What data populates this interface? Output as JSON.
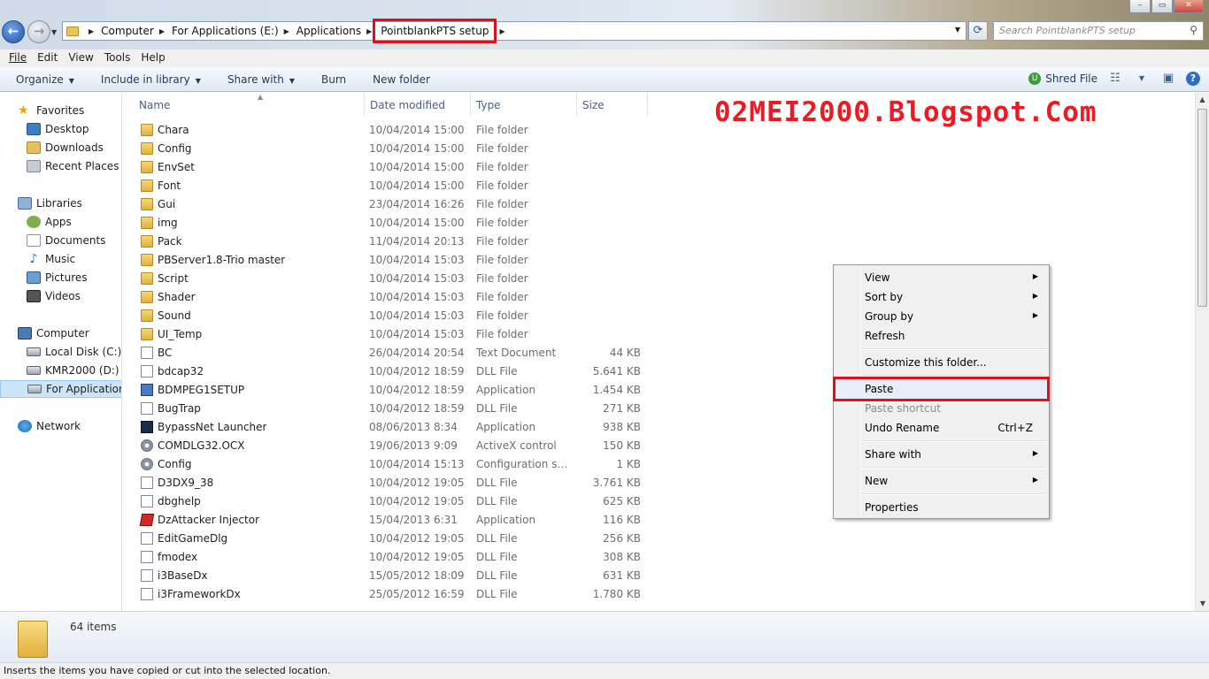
{
  "window": {
    "controls": [
      "–",
      "▭",
      "✕"
    ]
  },
  "address": {
    "crumbs": [
      "Computer",
      "For Applications (E:)",
      "Applications",
      "PointblankPTS setup"
    ],
    "search_placeholder": "Search PointblankPTS setup"
  },
  "menubar": [
    "File",
    "Edit",
    "View",
    "Tools",
    "Help"
  ],
  "commands": {
    "organize": "Organize",
    "include_in_library": "Include in library",
    "share_with": "Share with",
    "burn": "Burn",
    "new_folder": "New folder",
    "shred_file": "Shred File"
  },
  "nav": {
    "favorites": "Favorites",
    "desktop": "Desktop",
    "downloads": "Downloads",
    "recent_places": "Recent Places",
    "libraries": "Libraries",
    "apps": "Apps",
    "documents": "Documents",
    "music": "Music",
    "pictures": "Pictures",
    "videos": "Videos",
    "computer": "Computer",
    "local_disk": "Local Disk (C:)",
    "kmr2000": "KMR2000 (D:)",
    "for_applications": "For Applications",
    "network": "Network"
  },
  "columns": [
    "Name",
    "Date modified",
    "Type",
    "Size"
  ],
  "watermark": "02MEI2000.Blogspot.Com",
  "files": [
    {
      "icon": "folder",
      "name": "Chara",
      "date": "10/04/2014 15:00",
      "type": "File folder",
      "size": ""
    },
    {
      "icon": "folder",
      "name": "Config",
      "date": "10/04/2014 15:00",
      "type": "File folder",
      "size": ""
    },
    {
      "icon": "folder",
      "name": "EnvSet",
      "date": "10/04/2014 15:00",
      "type": "File folder",
      "size": ""
    },
    {
      "icon": "folder",
      "name": "Font",
      "date": "10/04/2014 15:00",
      "type": "File folder",
      "size": ""
    },
    {
      "icon": "folder",
      "name": "Gui",
      "date": "23/04/2014 16:26",
      "type": "File folder",
      "size": ""
    },
    {
      "icon": "folder",
      "name": "img",
      "date": "10/04/2014 15:00",
      "type": "File folder",
      "size": ""
    },
    {
      "icon": "folder",
      "name": "Pack",
      "date": "11/04/2014 20:13",
      "type": "File folder",
      "size": ""
    },
    {
      "icon": "folder",
      "name": "PBServer1.8-Trio master",
      "date": "10/04/2014 15:03",
      "type": "File folder",
      "size": ""
    },
    {
      "icon": "folder",
      "name": "Script",
      "date": "10/04/2014 15:03",
      "type": "File folder",
      "size": ""
    },
    {
      "icon": "folder",
      "name": "Shader",
      "date": "10/04/2014 15:03",
      "type": "File folder",
      "size": ""
    },
    {
      "icon": "folder",
      "name": "Sound",
      "date": "10/04/2014 15:03",
      "type": "File folder",
      "size": ""
    },
    {
      "icon": "folder",
      "name": "UI_Temp",
      "date": "10/04/2014 15:03",
      "type": "File folder",
      "size": ""
    },
    {
      "icon": "file",
      "name": "BC",
      "date": "26/04/2014 20:54",
      "type": "Text Document",
      "size": "44 KB"
    },
    {
      "icon": "file",
      "name": "bdcap32",
      "date": "10/04/2012 18:59",
      "type": "DLL File",
      "size": "5.641 KB"
    },
    {
      "icon": "app",
      "name": "BDMPEG1SETUP",
      "date": "10/04/2012 18:59",
      "type": "Application",
      "size": "1.454 KB"
    },
    {
      "icon": "file",
      "name": "BugTrap",
      "date": "10/04/2012 18:59",
      "type": "DLL File",
      "size": "271 KB"
    },
    {
      "icon": "dark",
      "name": "BypassNet Launcher",
      "date": "08/06/2013 8:34",
      "type": "Application",
      "size": "938 KB"
    },
    {
      "icon": "gear",
      "name": "COMDLG32.OCX",
      "date": "19/06/2013 9:09",
      "type": "ActiveX control",
      "size": "150 KB"
    },
    {
      "icon": "gear",
      "name": "Config",
      "date": "10/04/2014 15:13",
      "type": "Configuration sett...",
      "size": "1 KB"
    },
    {
      "icon": "file",
      "name": "D3DX9_38",
      "date": "10/04/2012 19:05",
      "type": "DLL File",
      "size": "3.761 KB"
    },
    {
      "icon": "file",
      "name": "dbghelp",
      "date": "10/04/2012 19:05",
      "type": "DLL File",
      "size": "625 KB"
    },
    {
      "icon": "red",
      "name": "DzAttacker Injector",
      "date": "15/04/2013 6:31",
      "type": "Application",
      "size": "116 KB"
    },
    {
      "icon": "file",
      "name": "EditGameDlg",
      "date": "10/04/2012 19:05",
      "type": "DLL File",
      "size": "256 KB"
    },
    {
      "icon": "file",
      "name": "fmodex",
      "date": "10/04/2012 19:05",
      "type": "DLL File",
      "size": "308 KB"
    },
    {
      "icon": "file",
      "name": "i3BaseDx",
      "date": "15/05/2012 18:09",
      "type": "DLL File",
      "size": "631 KB"
    },
    {
      "icon": "file",
      "name": "i3FrameworkDx",
      "date": "25/05/2012 16:59",
      "type": "DLL File",
      "size": "1.780 KB"
    }
  ],
  "context_menu": {
    "view": "View",
    "sort_by": "Sort by",
    "group_by": "Group by",
    "refresh": "Refresh",
    "customize": "Customize this folder...",
    "paste": "Paste",
    "paste_shortcut": "Paste shortcut",
    "undo_rename": "Undo Rename",
    "undo_shortcut": "Ctrl+Z",
    "share_with": "Share with",
    "new": "New",
    "properties": "Properties"
  },
  "details": {
    "items_count": "64 items"
  },
  "status": "Inserts the items you have copied or cut into the selected location.",
  "colors": {
    "highlight_red": "#d7131d",
    "watermark_red": "#ec1b23",
    "selection_blue": "#cce4f7"
  }
}
